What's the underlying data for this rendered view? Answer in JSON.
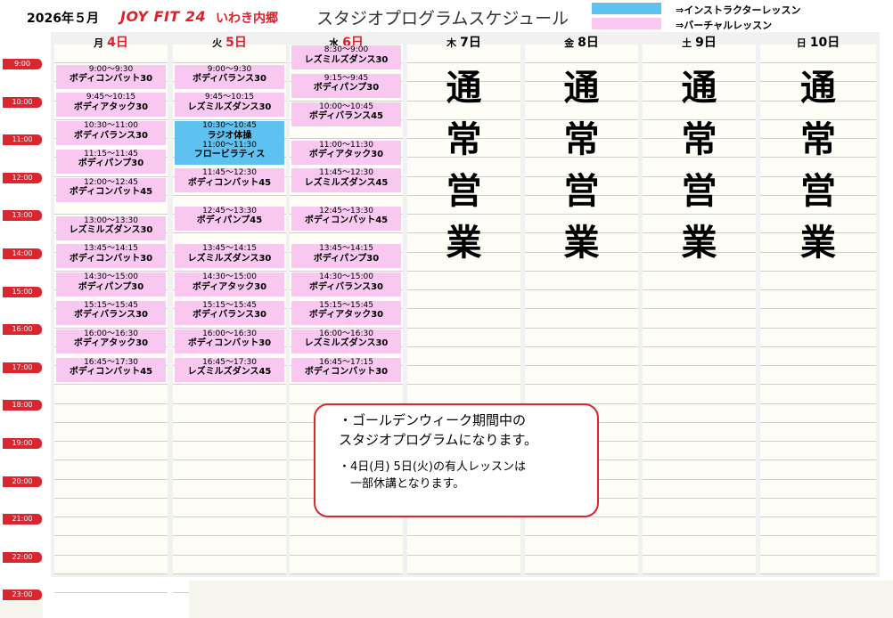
{
  "header": {
    "date": "2026年５月",
    "brand": "JOY FIT 24",
    "store": "いわき内郷",
    "title": "スタジオプログラムスケジュール"
  },
  "legend": [
    {
      "label": "⇒インストラクターレッスン",
      "color": "#5ec2f0"
    },
    {
      "label": "⇒バーチャルレッスン",
      "color": "#f8c8f0"
    }
  ],
  "time_labels": [
    "9:00",
    "10:00",
    "11:00",
    "12:00",
    "13:00",
    "14:00",
    "15:00",
    "16:00",
    "17:00",
    "18:00",
    "19:00",
    "20:00",
    "21:00",
    "22:00",
    "23:00"
  ],
  "days": [
    {
      "wd": "月",
      "num": "4日",
      "red": true
    },
    {
      "wd": "火",
      "num": "5日",
      "red": true
    },
    {
      "wd": "水",
      "num": "6日",
      "red": true
    },
    {
      "wd": "木",
      "num": "7日",
      "red": false
    },
    {
      "wd": "金",
      "num": "8日",
      "red": false
    },
    {
      "wd": "土",
      "num": "9日",
      "red": false
    },
    {
      "wd": "日",
      "num": "10日",
      "red": false
    }
  ],
  "lessons": {
    "mon": [
      {
        "time": "9:00～9:30",
        "name": "ボディコンバット30",
        "type": "virtual"
      },
      {
        "time": "9:45～10:15",
        "name": "ボディアタック30",
        "type": "virtual"
      },
      {
        "time": "10:30～11:00",
        "name": "ボディバランス30",
        "type": "virtual"
      },
      {
        "time": "11:15～11:45",
        "name": "ボディパンプ30",
        "type": "virtual"
      },
      {
        "time": "12:00～12:45",
        "name": "ボディコンバット45",
        "type": "virtual"
      },
      {
        "time": "13:00～13:30",
        "name": "レズミルズダンス30",
        "type": "virtual"
      },
      {
        "time": "13:45～14:15",
        "name": "ボディコンバット30",
        "type": "virtual"
      },
      {
        "time": "14:30～15:00",
        "name": "ボディパンプ30",
        "type": "virtual"
      },
      {
        "time": "15:15～15:45",
        "name": "ボディバランス30",
        "type": "virtual"
      },
      {
        "time": "16:00～16:30",
        "name": "ボディアタック30",
        "type": "virtual"
      },
      {
        "time": "16:45～17:30",
        "name": "ボディコンバット45",
        "type": "virtual"
      }
    ],
    "tue": [
      {
        "time": "9:00～9:30",
        "name": "ボディバランス30",
        "type": "virtual"
      },
      {
        "time": "9:45～10:15",
        "name": "レズミルズダンス30",
        "type": "virtual"
      },
      {
        "time": "10:30～10:45",
        "name": "ラジオ体操",
        "type": "instructor"
      },
      {
        "time": "11:00～11:30",
        "name": "フロービラティス",
        "type": "instructor"
      },
      {
        "time": "11:45～12:30",
        "name": "ボディコンバット45",
        "type": "virtual"
      },
      {
        "time": "12:45～13:30",
        "name": "ボディパンプ45",
        "type": "virtual"
      },
      {
        "time": "13:45～14:15",
        "name": "レズミルズダンス30",
        "type": "virtual"
      },
      {
        "time": "14:30～15:00",
        "name": "ボディアタック30",
        "type": "virtual"
      },
      {
        "time": "15:15～15:45",
        "name": "ボディバランス30",
        "type": "virtual"
      },
      {
        "time": "16:00～16:30",
        "name": "ボディコンバット30",
        "type": "virtual"
      },
      {
        "time": "16:45～17:30",
        "name": "レズミルズダンス45",
        "type": "virtual"
      }
    ],
    "wed": [
      {
        "time": "8:30～9:00",
        "name": "レズミルズダンス30",
        "type": "virtual"
      },
      {
        "time": "9:15～9:45",
        "name": "ボディパンプ30",
        "type": "virtual"
      },
      {
        "time": "10:00～10:45",
        "name": "ボディバランス45",
        "type": "virtual"
      },
      {
        "time": "11:00～11:30",
        "name": "ボディアタック30",
        "type": "virtual"
      },
      {
        "time": "11:45～12:30",
        "name": "レズミルズダンス45",
        "type": "virtual"
      },
      {
        "time": "12:45～13:30",
        "name": "ボディコンバット45",
        "type": "virtual"
      },
      {
        "time": "13:45～14:15",
        "name": "ボディパンプ30",
        "type": "virtual"
      },
      {
        "time": "14:30～15:00",
        "name": "ボディバランス30",
        "type": "virtual"
      },
      {
        "time": "15:15～15:45",
        "name": "ボディアタック30",
        "type": "virtual"
      },
      {
        "time": "16:00～16:30",
        "name": "レズミルズダンス30",
        "type": "virtual"
      },
      {
        "time": "16:45～17:15",
        "name": "ボディコンバット30",
        "type": "virtual"
      }
    ]
  },
  "normal_hours": [
    "通",
    "常",
    "営",
    "業"
  ],
  "notice": {
    "line1": "・ゴールデンウィーク期間中の",
    "line2": "スタジオプログラムになります。",
    "line3": "・4日(月) 5日(火)の有人レッスンは",
    "line4": "　一部休講となります。"
  }
}
